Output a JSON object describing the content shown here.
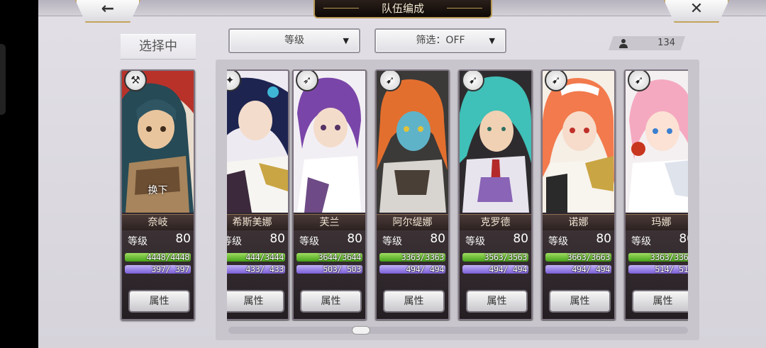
{
  "header": {
    "title": "队伍编成",
    "back_icon": "arrow-left-icon",
    "back_glyph": "←",
    "close_icon": "close-icon",
    "close_glyph": "✕"
  },
  "selected_panel": {
    "label": "选择中"
  },
  "sort": {
    "label": "等级",
    "arrow": "▼"
  },
  "filter": {
    "label": "筛选：OFF",
    "arrow": "▼"
  },
  "unit_count": {
    "icon": "person-icon",
    "value": "134"
  },
  "slot": {
    "name": "奈岐",
    "level_label": "等级",
    "level": "80",
    "hp": "4448/4448",
    "mp": "397/ 397",
    "button": "属性",
    "action": "换下",
    "class_icon": "axe-icon",
    "class_glyph": "⚒"
  },
  "roster": [
    {
      "name": "希斯美娜",
      "level_label": "等级",
      "level": "80",
      "hp": "444/3444",
      "mp": "433/ 433",
      "button": "属性",
      "class_icon": "staff-icon",
      "class_glyph": "✦"
    },
    {
      "name": "芙兰",
      "level_label": "等级",
      "level": "80",
      "hp": "3644/3644",
      "mp": "503/ 503",
      "button": "属性",
      "class_icon": "spear-icon",
      "class_glyph": "➶"
    },
    {
      "name": "阿尔缇娜",
      "level_label": "等级",
      "level": "80",
      "hp": "3363/3363",
      "mp": "494/ 494",
      "button": "属性",
      "class_icon": "bow-icon",
      "class_glyph": "➹"
    },
    {
      "name": "克罗德",
      "level_label": "等级",
      "level": "80",
      "hp": "3563/3563",
      "mp": "494/ 494",
      "button": "属性",
      "class_icon": "bow-icon",
      "class_glyph": "➹"
    },
    {
      "name": "诺娜",
      "level_label": "等级",
      "level": "80",
      "hp": "3663/3663",
      "mp": "494/ 494",
      "button": "属性",
      "class_icon": "bow-icon",
      "class_glyph": "➹"
    },
    {
      "name": "玛娜",
      "level_label": "等级",
      "level": "80",
      "hp": "3363/3363",
      "mp": "514/ 514",
      "button": "属性",
      "class_icon": "bow-icon",
      "class_glyph": "➹"
    }
  ],
  "colors": {
    "hp_bar": "#46a318",
    "mp_bar": "#7a5ed8",
    "frame_gold": "#c4a45c"
  }
}
